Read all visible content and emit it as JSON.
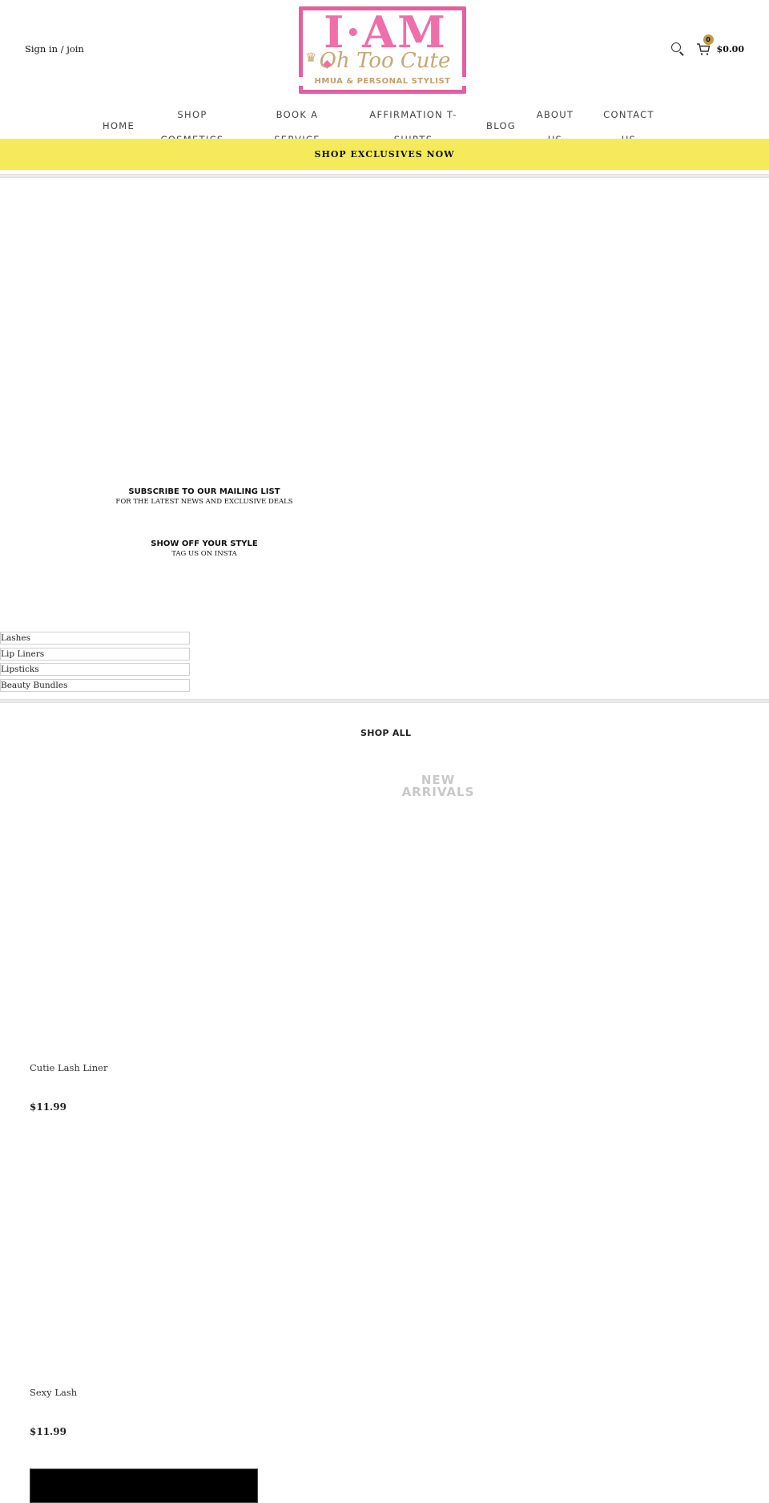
{
  "header": {
    "signin_label": "Sign in / join",
    "logo": {
      "title": "I·AM",
      "script": "Oh Too Cute",
      "subtitle": "HMUA & PERSONAL STYLIST",
      "frame_color": "#e45fa0",
      "accent_gold": "#c4a06d"
    },
    "search_icon": "search-icon",
    "cart": {
      "icon": "cart-icon",
      "count": "0",
      "total": "$0.00",
      "badge_color": "#c39a45"
    }
  },
  "nav": {
    "items": [
      {
        "label": "HOME"
      },
      {
        "label": "SHOP\nCOSMETICS"
      },
      {
        "label": "BOOK A\nSERVICE"
      },
      {
        "label": "AFFIRMATION T-\nSHIRTS"
      },
      {
        "label": "BLOG"
      },
      {
        "label": "ABOUT\nUS"
      },
      {
        "label": "CONTACT\nUS"
      }
    ]
  },
  "banner": {
    "label": "SHOP EXCLUSIVES NOW",
    "color": "#f4ea5a"
  },
  "mailing": {
    "title": "SUBSCRIBE TO OUR MAILING LIST",
    "subtitle": "FOR THE LATEST NEWS AND EXCLUSIVE DEALS"
  },
  "insta": {
    "title": "SHOW OFF YOUR STYLE",
    "subtitle": "TAG US ON INSTA"
  },
  "categories": [
    {
      "label": "Lashes"
    },
    {
      "label": "Lip Liners"
    },
    {
      "label": "Lipsticks"
    },
    {
      "label": "Beauty Bundles"
    }
  ],
  "shop_all_label": "SHOP ALL",
  "new_arrivals_label": "NEW ARRIVALS",
  "products": [
    {
      "name": "Cutie Lash Liner",
      "price": "$11.99"
    },
    {
      "name": "Sexy Lash",
      "price": "$11.99"
    }
  ]
}
